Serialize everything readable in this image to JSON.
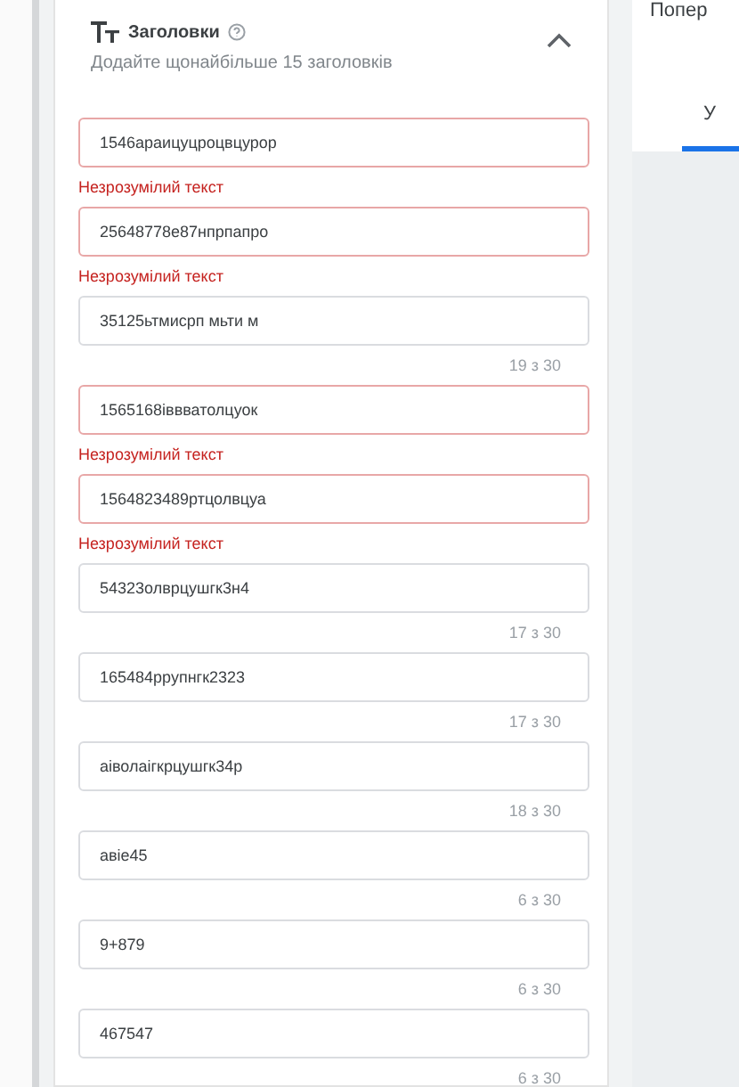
{
  "section": {
    "title": "Заголовки",
    "subtitle": "Додайте щонайбільше 15 заголовків",
    "expanded": true
  },
  "headlines": [
    {
      "value": "1546араицуцроцвцурор",
      "error": true,
      "message": "Незрозумілий текст"
    },
    {
      "value": "25648778е87нпрпапро",
      "error": true,
      "message": "Незрозумілий текст"
    },
    {
      "value": "35125ьтмисрп мьти м",
      "error": false,
      "counter": "19 з 30"
    },
    {
      "value": "1565168іввватолцуок",
      "error": true,
      "message": "Незрозумілий текст"
    },
    {
      "value": "1564823489ртцолвцуа",
      "error": true,
      "message": "Незрозумілий текст"
    },
    {
      "value": "54323олврцушгк3н4",
      "error": false,
      "counter": "17 з 30"
    },
    {
      "value": "165484ррупнгк2323",
      "error": false,
      "counter": "17 з 30"
    },
    {
      "value": "аіволаігкрцушгк34р",
      "error": false,
      "counter": "18 з 30"
    },
    {
      "value": "авіе45",
      "error": false,
      "counter": "6 з 30"
    },
    {
      "value": "9+879",
      "error": false,
      "counter": "6 з 30"
    },
    {
      "value": "467547",
      "error": false,
      "counter": "6 з 30"
    }
  ],
  "side_panel": {
    "heading": "Попер",
    "tabs": [
      {
        "label": "У",
        "selected": true
      }
    ]
  }
}
